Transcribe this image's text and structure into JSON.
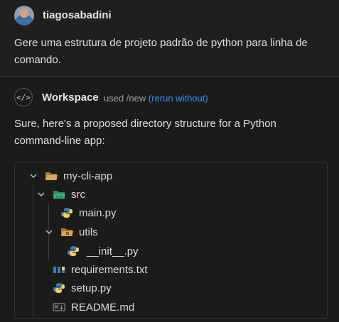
{
  "user": {
    "name": "tiagosabadini",
    "message": "Gere uma estrutura de projeto padrão de python para linha de comando."
  },
  "assistant": {
    "icon": "code-icon",
    "name": "Workspace",
    "meta": "used /new",
    "rerun_label": "(rerun without)",
    "reply": "Sure, here's a proposed directory structure for a Python command-line app:"
  },
  "tree": {
    "items": [
      {
        "label": "my-cli-app",
        "icon": "folder-open-icon"
      },
      {
        "label": "src",
        "icon": "folder-src-icon"
      },
      {
        "label": "main.py",
        "icon": "python-icon"
      },
      {
        "label": "utils",
        "icon": "folder-utils-icon"
      },
      {
        "label": "__init__.py",
        "icon": "python-icon"
      },
      {
        "label": "requirements.txt",
        "icon": "pip-icon"
      },
      {
        "label": "setup.py",
        "icon": "python-icon"
      },
      {
        "label": "README.md",
        "icon": "markdown-icon"
      }
    ]
  },
  "colors": {
    "link": "#3794ff",
    "folder": "#c09553",
    "src_folder": "#3aa675",
    "python_blue": "#3e7ab3",
    "python_yellow": "#f7d44c"
  }
}
